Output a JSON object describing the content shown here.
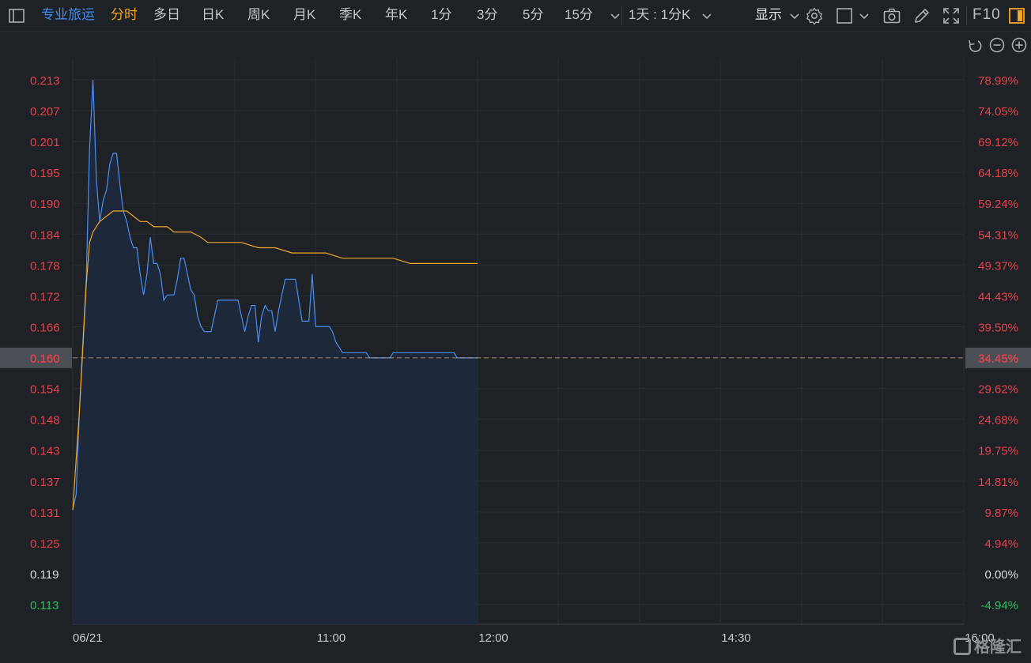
{
  "toolbar": {
    "stock_name": "专业旅运",
    "periods": [
      "分时",
      "多日",
      "日K",
      "周K",
      "月K",
      "季K",
      "年K",
      "1分",
      "3分",
      "5分",
      "15分"
    ],
    "active_period": "分时",
    "multi_period": "1天 : 1分K",
    "display_label": "显示",
    "f10_label": "F10",
    "icons": [
      "sidebar-toggle-icon",
      "more-periods-chevron-icon",
      "multi-period-chevron-icon",
      "display-chevron-icon",
      "settings-gear-icon",
      "square-icon",
      "square-chevron-icon",
      "camera-icon",
      "pencil-icon",
      "fullscreen-icon",
      "panel-toggle-icon"
    ]
  },
  "chart_controls": {
    "icons": [
      "reset-icon",
      "zoom-out-icon",
      "zoom-in-icon"
    ]
  },
  "watermark": "格隆汇",
  "chart_data": {
    "type": "line",
    "ylim": [
      0.113,
      0.213
    ],
    "ylim_percent": [
      -4.94,
      78.99
    ],
    "y_ticks": [
      "0.213",
      "0.207",
      "0.201",
      "0.195",
      "0.190",
      "0.184",
      "0.178",
      "0.172",
      "0.166",
      "0.160",
      "0.154",
      "0.148",
      "0.143",
      "0.137",
      "0.131",
      "0.125",
      "0.119",
      "0.113"
    ],
    "y_ticks_right": [
      "78.99%",
      "74.05%",
      "69.12%",
      "64.18%",
      "59.24%",
      "54.31%",
      "49.37%",
      "44.43%",
      "39.50%",
      "34.45%",
      "29.62%",
      "24.68%",
      "19.75%",
      "14.81%",
      "9.87%",
      "4.94%",
      "0.00%",
      "-4.94%"
    ],
    "x_ticks": [
      "06/21",
      "11:00",
      "12:00",
      "14:30",
      "16:00"
    ],
    "prev_close": 0.119,
    "current_price": 0.16,
    "current_price_label": "0.160",
    "current_percent_label": "34.45%",
    "colors": {
      "up": "#e8414a",
      "down": "#2ebd5a",
      "flat": "#d8dbe0",
      "price_line": "#4a8ff0",
      "avg_line": "#f0a72d",
      "area_fill": "#1d2a3d",
      "grid": "#2a2e34",
      "ref_line": "#c8a070"
    },
    "series": [
      {
        "name": "price",
        "x": [
          0,
          1,
          2,
          3,
          4,
          5,
          6,
          7,
          8,
          9,
          10,
          11,
          12,
          13,
          14,
          15,
          16,
          17,
          18,
          19,
          20,
          21,
          22,
          23,
          24,
          25,
          26,
          27,
          28,
          29,
          30,
          31,
          32,
          33,
          34,
          35,
          36,
          37,
          38,
          39,
          40,
          41,
          42,
          43,
          44,
          45,
          46,
          47,
          48,
          49,
          50,
          51,
          52,
          53,
          54,
          55,
          56,
          57,
          58,
          59,
          60,
          61,
          62,
          63,
          64,
          65,
          66,
          67,
          68,
          69,
          70,
          71,
          72,
          73,
          74,
          75,
          76,
          77,
          78,
          79,
          80,
          81,
          82,
          83,
          84,
          85,
          86,
          87,
          88,
          89,
          90,
          91,
          92,
          93,
          94,
          95,
          96,
          97,
          98,
          99,
          100,
          101,
          102,
          103,
          104,
          105,
          106,
          107,
          108,
          109,
          110,
          111,
          112,
          113,
          114,
          115,
          116,
          117,
          118,
          119,
          120
        ],
        "values": [
          0.131,
          0.134,
          0.15,
          0.163,
          0.175,
          0.2,
          0.213,
          0.194,
          0.186,
          0.19,
          0.192,
          0.197,
          0.199,
          0.199,
          0.193,
          0.188,
          0.186,
          0.183,
          0.181,
          0.181,
          0.176,
          0.172,
          0.176,
          0.183,
          0.178,
          0.178,
          0.176,
          0.171,
          0.172,
          0.172,
          0.172,
          0.175,
          0.179,
          0.179,
          0.176,
          0.173,
          0.172,
          0.168,
          0.166,
          0.165,
          0.165,
          0.165,
          0.168,
          0.171,
          0.171,
          0.171,
          0.171,
          0.171,
          0.171,
          0.171,
          0.168,
          0.165,
          0.168,
          0.17,
          0.17,
          0.163,
          0.168,
          0.17,
          0.169,
          0.169,
          0.165,
          0.169,
          0.172,
          0.175,
          0.175,
          0.175,
          0.175,
          0.171,
          0.167,
          0.167,
          0.167,
          0.176,
          0.166,
          0.166,
          0.166,
          0.166,
          0.166,
          0.165,
          0.163,
          0.162,
          0.161,
          0.161,
          0.161,
          0.161,
          0.161,
          0.161,
          0.161,
          0.161,
          0.16,
          0.16,
          0.16,
          0.16,
          0.16,
          0.16,
          0.16,
          0.161,
          0.161,
          0.161,
          0.161,
          0.161,
          0.161,
          0.161,
          0.161,
          0.161,
          0.161,
          0.161,
          0.161,
          0.161,
          0.161,
          0.161,
          0.161,
          0.161,
          0.161,
          0.161,
          0.16,
          0.16,
          0.16,
          0.16,
          0.16,
          0.16,
          0.16
        ]
      },
      {
        "name": "average",
        "x": [
          0,
          2,
          3,
          4,
          5,
          6,
          8,
          10,
          12,
          14,
          16,
          18,
          20,
          22,
          24,
          26,
          28,
          30,
          32,
          35,
          38,
          40,
          43,
          45,
          50,
          55,
          60,
          65,
          70,
          75,
          80,
          85,
          90,
          95,
          100,
          105,
          110,
          115,
          120
        ],
        "values": [
          0.131,
          0.15,
          0.162,
          0.174,
          0.182,
          0.184,
          0.186,
          0.187,
          0.188,
          0.188,
          0.188,
          0.187,
          0.186,
          0.186,
          0.185,
          0.185,
          0.185,
          0.184,
          0.184,
          0.184,
          0.183,
          0.182,
          0.182,
          0.182,
          0.182,
          0.181,
          0.181,
          0.18,
          0.18,
          0.18,
          0.179,
          0.179,
          0.179,
          0.179,
          0.178,
          0.178,
          0.178,
          0.178,
          0.178
        ]
      }
    ]
  }
}
